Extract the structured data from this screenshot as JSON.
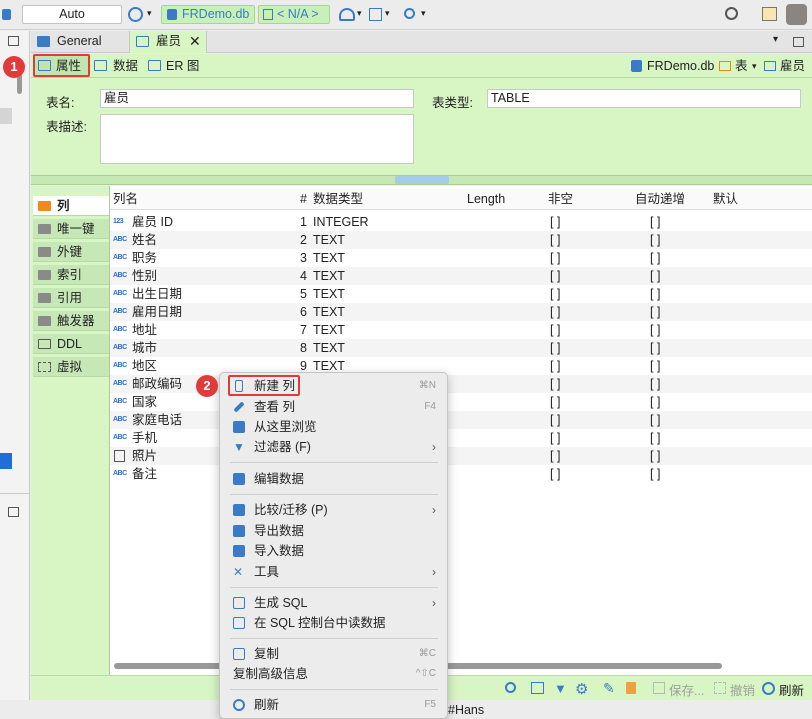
{
  "toolbar": {
    "auto_label": "Auto",
    "db_label": "FRDemo.db",
    "schema_label": "< N/A >"
  },
  "tabs": [
    {
      "label": "General"
    },
    {
      "label": "雇员"
    }
  ],
  "subtabs": [
    {
      "label": "属性"
    },
    {
      "label": "数据"
    },
    {
      "label": "ER 图"
    }
  ],
  "crumbs": {
    "db": "FRDemo.db",
    "type": "表",
    "table": "雇员"
  },
  "props": {
    "name_label": "表名:",
    "name_value": "雇员",
    "type_label": "表类型:",
    "type_value": "TABLE",
    "desc_label": "表描述:"
  },
  "sidebar": [
    {
      "label": "列"
    },
    {
      "label": "唯一键"
    },
    {
      "label": "外键"
    },
    {
      "label": "索引"
    },
    {
      "label": "引用"
    },
    {
      "label": "触发器"
    },
    {
      "label": "DDL"
    },
    {
      "label": "虚拟"
    }
  ],
  "columns": {
    "name": "列名",
    "num": "#",
    "type": "数据类型",
    "length": "Length",
    "notnull": "非空",
    "autoinc": "自动递增",
    "default": "默认"
  },
  "rows": [
    {
      "name": "雇员 ID",
      "num": "1",
      "type": "INTEGER",
      "notnull": "[ ]",
      "autoinc": "[ ]"
    },
    {
      "name": "姓名",
      "num": "2",
      "type": "TEXT",
      "notnull": "[ ]",
      "autoinc": "[ ]"
    },
    {
      "name": "职务",
      "num": "3",
      "type": "TEXT",
      "notnull": "[ ]",
      "autoinc": "[ ]"
    },
    {
      "name": "性别",
      "num": "4",
      "type": "TEXT",
      "notnull": "[ ]",
      "autoinc": "[ ]"
    },
    {
      "name": "出生日期",
      "num": "5",
      "type": "TEXT",
      "notnull": "[ ]",
      "autoinc": "[ ]"
    },
    {
      "name": "雇用日期",
      "num": "6",
      "type": "TEXT",
      "notnull": "[ ]",
      "autoinc": "[ ]"
    },
    {
      "name": "地址",
      "num": "7",
      "type": "TEXT",
      "notnull": "[ ]",
      "autoinc": "[ ]"
    },
    {
      "name": "城市",
      "num": "8",
      "type": "TEXT",
      "notnull": "[ ]",
      "autoinc": "[ ]"
    },
    {
      "name": "地区",
      "num": "9",
      "type": "TEXT",
      "notnull": "[ ]",
      "autoinc": "[ ]"
    },
    {
      "name": "邮政编码",
      "num": "",
      "type": "",
      "notnull": "[ ]",
      "autoinc": "[ ]"
    },
    {
      "name": "国家",
      "num": "",
      "type": "",
      "notnull": "[ ]",
      "autoinc": "[ ]"
    },
    {
      "name": "家庭电话",
      "num": "",
      "type": "",
      "notnull": "[ ]",
      "autoinc": "[ ]"
    },
    {
      "name": "手机",
      "num": "",
      "type": "",
      "notnull": "[ ]",
      "autoinc": "[ ]"
    },
    {
      "name": "照片",
      "num": "",
      "type": "",
      "notnull": "[ ]",
      "autoinc": "[ ]"
    },
    {
      "name": "备注",
      "num": "",
      "type": "",
      "notnull": "[ ]",
      "autoinc": "[ ]"
    }
  ],
  "menu": [
    {
      "label": "新建 列",
      "shortcut": "⌘N"
    },
    {
      "label": "查看 列",
      "shortcut": "F4"
    },
    {
      "label": "从这里浏览",
      "shortcut": ""
    },
    {
      "label": "过滤器 (F)",
      "shortcut": ""
    },
    {
      "label": "编辑数据",
      "shortcut": ""
    },
    {
      "label": "比较/迁移 (P)",
      "shortcut": ""
    },
    {
      "label": "导出数据",
      "shortcut": ""
    },
    {
      "label": "导入数据",
      "shortcut": ""
    },
    {
      "label": "工具",
      "shortcut": ""
    },
    {
      "label": "生成 SQL",
      "shortcut": ""
    },
    {
      "label": "在 SQL 控制台中读数据",
      "shortcut": ""
    },
    {
      "label": "复制",
      "shortcut": "⌘C"
    },
    {
      "label": "复制高级信息",
      "shortcut": "^⇧C"
    },
    {
      "label": "刷新",
      "shortcut": "F5"
    }
  ],
  "footer": {
    "save": "保存...",
    "cancel": "撤销",
    "refresh": "刷新"
  },
  "status": {
    "text": "#Hans"
  },
  "badges": {
    "one": "1",
    "two": "2"
  },
  "colors": {
    "accent": "#3a7bc8",
    "panel": "#d8f5c4",
    "badge": "#e03a3a"
  }
}
